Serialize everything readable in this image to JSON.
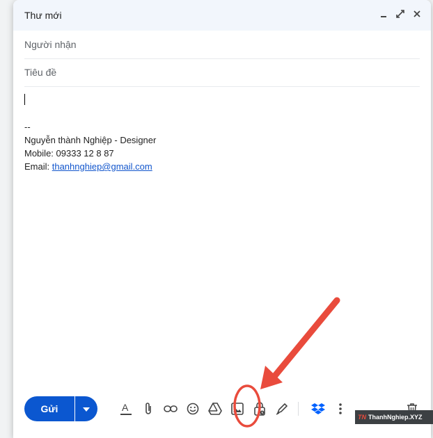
{
  "header": {
    "title": "Thư mới"
  },
  "fields": {
    "recipients_placeholder": "Người nhận",
    "subject_placeholder": "Tiêu đề"
  },
  "signature": {
    "separator": "--",
    "name_line": "Nguyễn thành Nghiệp - Designer",
    "mobile_line": "Mobile: 09333 12 8 87",
    "email_prefix": "Email: ",
    "email": "thanhnghiep@gmail.com"
  },
  "toolbar": {
    "send_label": "Gửi"
  },
  "icons": [
    "minimize-icon",
    "expand-icon",
    "close-icon",
    "chevron-down-icon",
    "format-text-icon",
    "attach-icon",
    "link-icon",
    "emoji-icon",
    "drive-icon",
    "image-icon",
    "confidential-lock-icon",
    "signature-pen-icon",
    "dropbox-icon",
    "more-options-icon",
    "trash-icon"
  ],
  "watermark": {
    "logo": "TN",
    "text": "ThanhNghiep.XYZ"
  },
  "colors": {
    "accent": "#0b57d0",
    "annotation": "#e94b3c",
    "link": "#1155cc",
    "dropbox": "#0061ff"
  }
}
